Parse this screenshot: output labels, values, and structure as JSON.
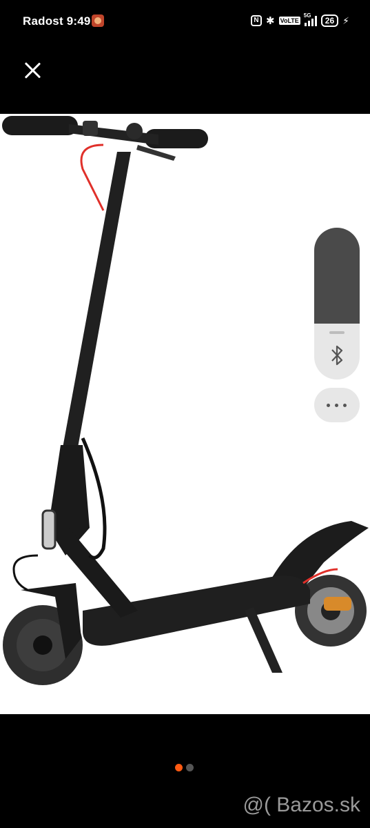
{
  "status_bar": {
    "carrier": "Radost 9:49",
    "volte": "VoLTE",
    "network": "5G",
    "battery": "26"
  },
  "viewer": {
    "close_icon": "close-icon",
    "image_subject": "electric-scooter-photo",
    "pager": {
      "current": 1,
      "total": 2,
      "active_color": "#ff5a12"
    },
    "watermark": "@( Bazos.sk"
  },
  "side_panel": {
    "brightness_level": 0.63,
    "bluetooth_icon": "bluetooth-icon",
    "more_icon": "more-horizontal-icon"
  }
}
